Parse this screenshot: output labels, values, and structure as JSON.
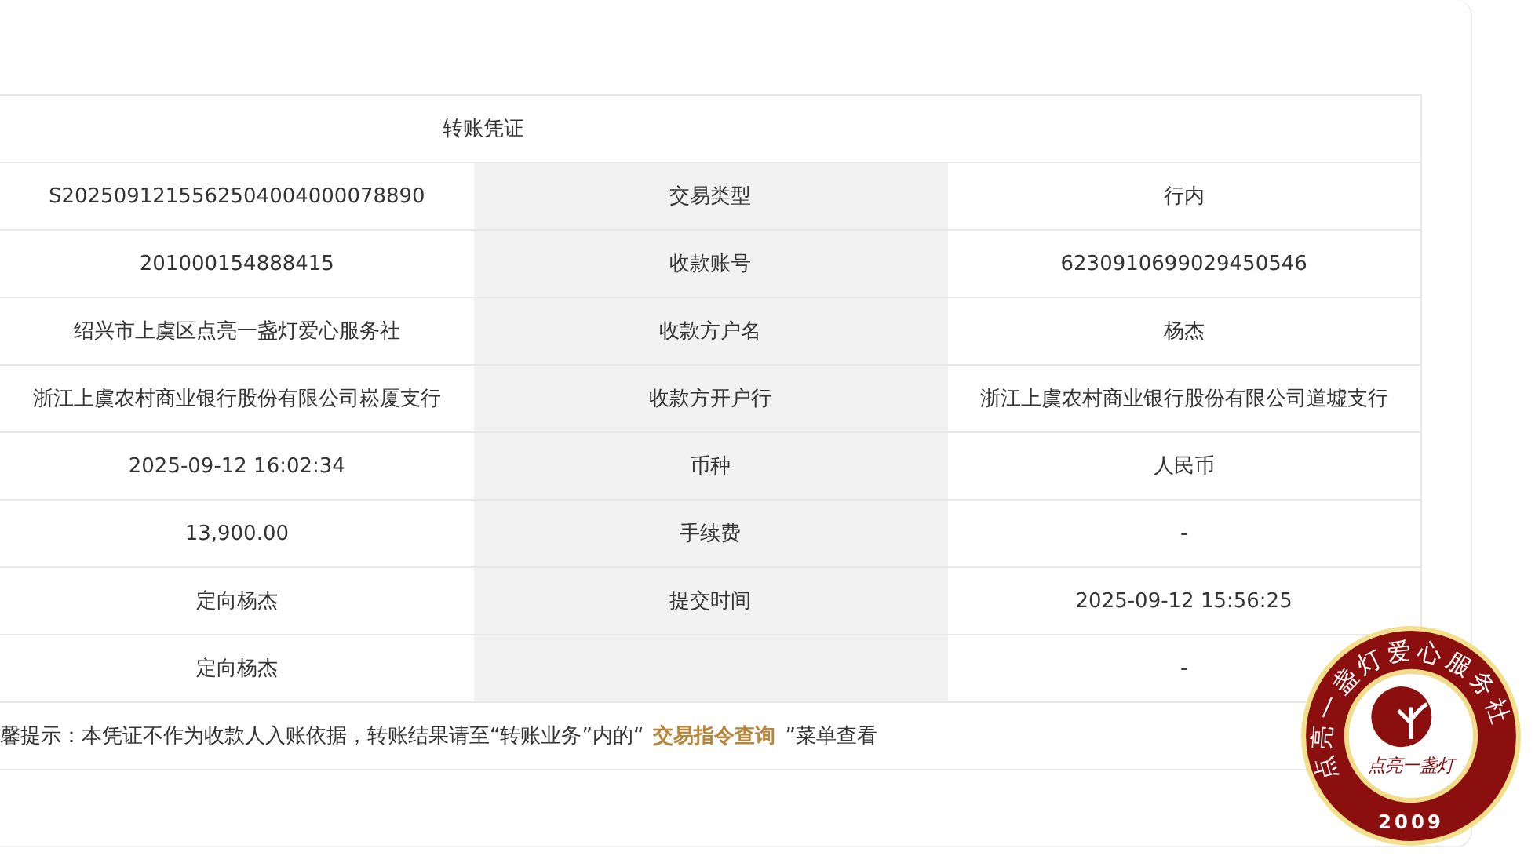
{
  "voucher": {
    "title": "转账凭证",
    "rows": [
      {
        "value": "S2025091215562504004000078890",
        "label": "交易类型",
        "detail": "行内"
      },
      {
        "value": "201000154888415",
        "label": "收款账号",
        "detail": "6230910699029450546"
      },
      {
        "value": "绍兴市上虞区点亮一盏灯爱心服务社",
        "label": "收款方户名",
        "detail": "杨杰"
      },
      {
        "value": "浙江上虞农村商业银行股份有限公司崧厦支行",
        "label": "收款方开户行",
        "detail": "浙江上虞农村商业银行股份有限公司道墟支行"
      },
      {
        "value": "2025-09-12 16:02:34",
        "label": "币种",
        "detail": "人民币"
      },
      {
        "value": "13,900.00",
        "label": "手续费",
        "detail": "-"
      },
      {
        "value": "定向杨杰",
        "label": "提交时间",
        "detail": "2025-09-12 15:56:25"
      },
      {
        "value": "定向杨杰",
        "detail": "-"
      }
    ],
    "notice": {
      "before": "馨提示：本凭证不作为收款人入账依据，转账结果请至“转账业务”内的“",
      "link": "交易指令查询",
      "after": "”菜单查看"
    }
  },
  "seal": {
    "ring_text": "点亮一盏灯爱心服务社",
    "center_text": "点亮一盏灯",
    "year": "2009"
  }
}
